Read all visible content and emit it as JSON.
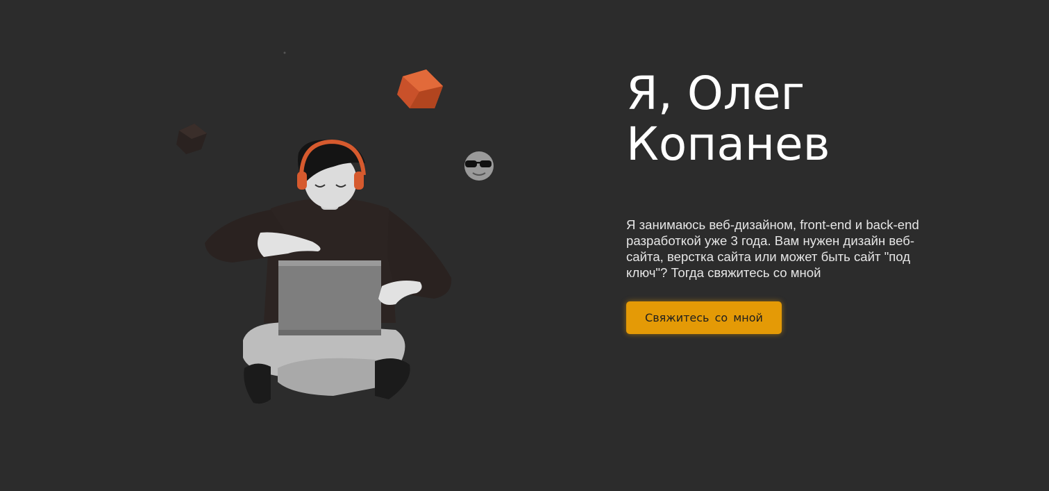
{
  "hero": {
    "title_line1": "Я, Олег",
    "title_line2": "Копанев",
    "description": "Я занимаюсь веб-дизайном, front-end и back-end разработкой уже 3 года. Вам нужен дизайн веб-сайта, верстка сайта или может быть сайт \"под ключ\"? Тогда свяжитесь со мной",
    "cta_label": "Свяжитесь со мной"
  },
  "illustration": {
    "subject": "3d-character-with-laptop-and-headphones",
    "accent_color": "#d65a2e"
  },
  "colors": {
    "background": "#2c2c2c",
    "title": "#ffffff",
    "text": "#e6e6e6",
    "button": "#e49a06",
    "button_text": "#1e1e1e"
  }
}
